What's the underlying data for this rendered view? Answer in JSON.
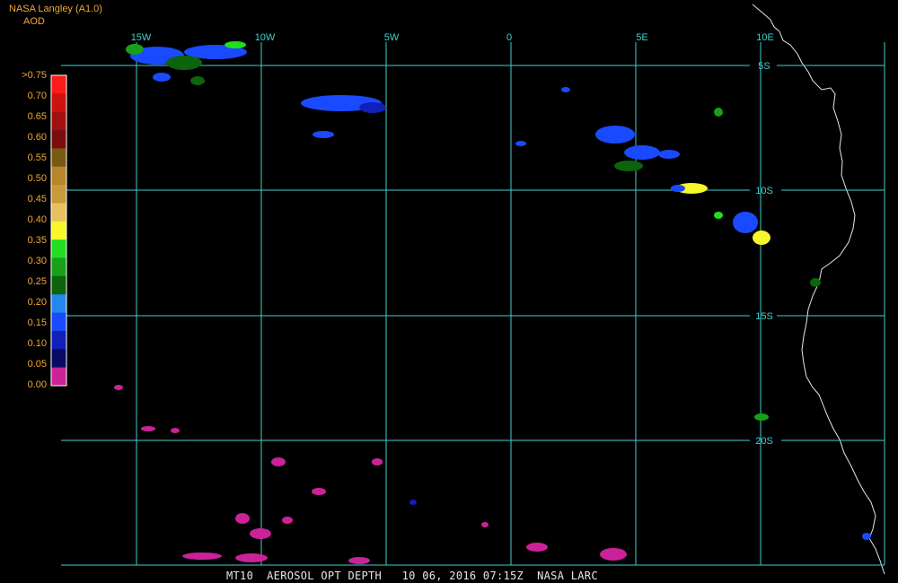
{
  "header": {
    "source": "NASA Langley (A1.0)",
    "product": "AOD"
  },
  "legend": {
    "labels": [
      ">0.75",
      "0.70",
      "0.65",
      "0.60",
      "0.55",
      "0.50",
      "0.45",
      "0.40",
      "0.35",
      "0.30",
      "0.25",
      "0.20",
      "0.15",
      "0.10",
      "0.05",
      "0.00"
    ],
    "colors": [
      "#ff1a1a",
      "#cc1111",
      "#a01010",
      "#7a0e0e",
      "#7a5a12",
      "#b8862a",
      "#c89a3c",
      "#e8c060",
      "#f7f72a",
      "#22dd22",
      "#18a018",
      "#0c640c",
      "#2288ee",
      "#1a4aff",
      "#1020b8",
      "#0a0a66",
      "#cc2299"
    ]
  },
  "grid": {
    "lon_labels": [
      "15W",
      "10W",
      "5W",
      "0",
      "5E",
      "10E"
    ],
    "lat_labels": [
      "5S",
      "10S",
      "15S",
      "20S"
    ],
    "line_color": "#40d0d0"
  },
  "footer": "MT10  AEROSOL OPT DEPTH   10 06, 2016 07:15Z  NASA LARC"
}
